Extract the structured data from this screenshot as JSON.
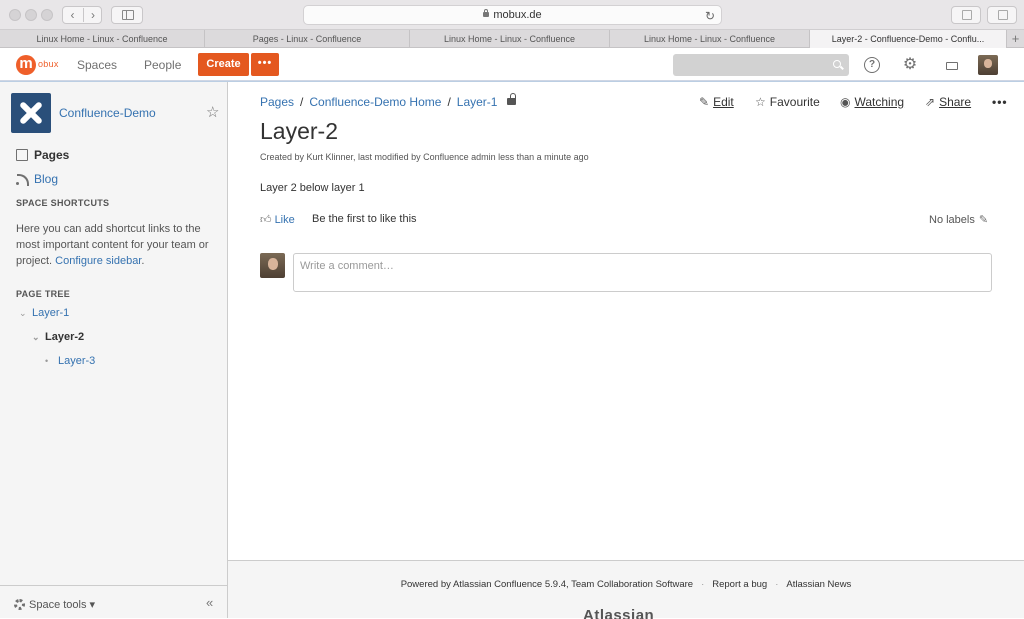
{
  "browser": {
    "url": "mobux.de",
    "tabs": [
      {
        "label": "Linux Home - Linux - Confluence",
        "active": false
      },
      {
        "label": "Pages - Linux - Confluence",
        "active": false
      },
      {
        "label": "Linux Home - Linux - Confluence",
        "active": false
      },
      {
        "label": "Linux Home - Linux - Confluence",
        "active": false
      },
      {
        "label": "Layer-2 - Confluence-Demo - Conflu...",
        "active": true
      }
    ],
    "new_tab": "+"
  },
  "header": {
    "logo_letter": "m",
    "logo_text": "obux",
    "nav": [
      "Spaces",
      "People"
    ],
    "create_label": "Create",
    "more_label": "•••",
    "search_placeholder": "",
    "help_icon": "?",
    "accent": "#e4581f"
  },
  "sidebar": {
    "space_name": "Confluence-Demo",
    "items": [
      {
        "label": "Pages"
      },
      {
        "label": "Blog"
      }
    ],
    "shortcuts_heading": "SPACE SHORTCUTS",
    "shortcuts_text": "Here you can add shortcut links to the most important content for your team or project.",
    "shortcuts_link": "Configure sidebar",
    "shortcuts_end": ".",
    "tree_heading": "PAGE TREE",
    "tree": [
      {
        "label": "Layer-1",
        "twisty": "⌄"
      },
      {
        "label": "Layer-2",
        "twisty": "⌄"
      },
      {
        "label": "Layer-3",
        "twisty": "•"
      }
    ],
    "space_tools": "Space tools",
    "collapse": "«"
  },
  "page": {
    "breadcrumbs": [
      "Pages",
      "Confluence-Demo Home",
      "Layer-1"
    ],
    "separator": "/",
    "actions": {
      "edit": "Edit",
      "favourite": "Favourite",
      "watching": "Watching",
      "share": "Share",
      "more": "•••"
    },
    "title": "Layer-2",
    "byline": "Created by Kurt Klinner, last modified by Confluence admin less than a minute ago",
    "body": "Layer 2 below layer 1",
    "like": "Like",
    "like_prompt": "Be the first to like this",
    "labels": "No labels",
    "comment_placeholder": "Write a comment…"
  },
  "footer": {
    "powered": "Powered by Atlassian Confluence 5.9.4, Team Collaboration Software",
    "report": "Report a bug",
    "news": "Atlassian News",
    "separator": "·",
    "brand": "Atlassian"
  }
}
